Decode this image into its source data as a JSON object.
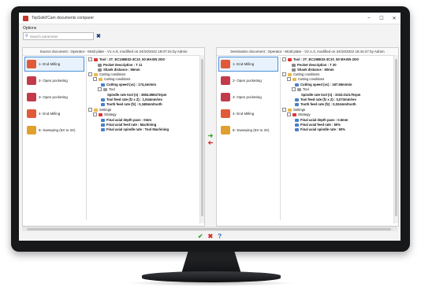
{
  "window": {
    "title": "TopSolid'Cam documents comparer",
    "minimize": "–",
    "maximize": "☐",
    "close": "✕"
  },
  "menu": {
    "options": "Options"
  },
  "search": {
    "placeholder": "Search parameter"
  },
  "left": {
    "header": "Source document : Operator - Mold plate - V1.A.9, modified on 24/10/2022 18:07:24 by Admin",
    "operations": [
      "1- End Milling",
      "2- Open pocketing",
      "3- Open pocketing",
      "4- End Milling",
      "8- Sweeping (5X to 3X)"
    ],
    "tree": [
      "Tool : 2T_EC10BE32-3C10_50 MAXIN 20X!",
      "Pocket description : T 11",
      "Shank distance : 65mm",
      "Cutting conditions",
      "Cutting conditions",
      "Cutting speed (vc) : 174,4m/min",
      "Tool",
      "Spindle rate tool (n) : 3804.869473rpm",
      "Tool feed rate (fz x Z) : 1,044mm/rev",
      "Tooth feed rate (fz) : 0,348mm/tooth",
      "Settings",
      "Strategy",
      "Final axial depth pass : 0mm",
      "Final axial feed rate : Machining",
      "Final axial spindle rate : Tool Machining"
    ]
  },
  "right": {
    "header": "Destination document : Operator - Mold plate - V2.A.3, modified on 24/10/2022 18:44:27 by Admin",
    "operations": [
      "1- End Milling",
      "2- Open pocketing",
      "3- Open pocketing",
      "4- End Milling",
      "8- Sweeping (5X to 3X)"
    ],
    "tree": [
      "Tool : 2T_EC10BE32-3C10_50 MAXIN 20X!",
      "Pocket description : T 20",
      "Shank distance : 60mm",
      "Cutting conditions",
      "Cutting conditions",
      "Cutting speed (vc) : 187.55m/min",
      "Tool",
      "Spindle rate tool (n) : 3310.012175rpm",
      "Tool feed rate (fz x Z) : 0,073mm/rev",
      "Tooth feed rate (fz) : 0,024mm/tooth",
      "Settings",
      "Strategy",
      "Final axial depth pass : 0.5mm",
      "Final axial feed rate : 50%",
      "Final axial spindle rate : 50%"
    ]
  },
  "footer": {
    "ok": "✔",
    "cancel": "✖",
    "help": "?"
  },
  "colors": {
    "accent": "#4a90d9",
    "ok": "#3aa534",
    "cancel": "#d92b2b",
    "help": "#2a60b8"
  }
}
